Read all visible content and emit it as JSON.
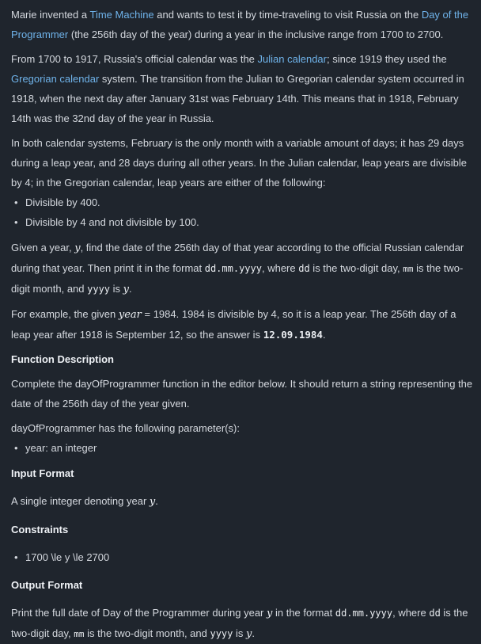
{
  "intro": {
    "t1": "Marie invented a ",
    "time_machine_link": "Time Machine",
    "t2": " and wants to test it by time-traveling to visit Russia on the ",
    "day_link": "Day of the Programmer",
    "t3": " (the 256th day of the year) during a year in the inclusive range from 1700 to 2700."
  },
  "history": {
    "t1": "From 1700 to 1917, Russia's official calendar was the ",
    "julian_link": "Julian calendar",
    "t2": "; since 1919 they used the ",
    "gregorian_link": "Gregorian calendar",
    "t3": " system. The transition from the Julian to Gregorian calendar system occurred in 1918, when the next day after January 31st was February 14th. This means that in 1918, February 14th was the 32nd day of the year in Russia."
  },
  "leap": {
    "text": "In both calendar systems, February is the only month with a variable amount of days; it has 29 days during a leap year, and 28 days during all other years. In the Julian calendar, leap years are divisible by 4; in the Gregorian calendar, leap years are either of the following:",
    "rules": [
      "Divisible by 400.",
      "Divisible by 4 and not divisible by 100."
    ]
  },
  "task": {
    "t1": "Given a year, ",
    "var_y": "y",
    "t2": ", find the date of the 256th day of that year according to the official Russian calendar during that year. Then print it in the format ",
    "fmt": "dd.mm.yyyy",
    "t3": ", where ",
    "dd": "dd",
    "t4": " is the two-digit day, ",
    "mm": "mm",
    "t5": " is the two-digit month, and ",
    "yyyy": "yyyy",
    "t6": " is ",
    "var_y2": "y",
    "t7": "."
  },
  "example": {
    "t1": "For example, the given ",
    "var_year": "year",
    "t2": " = 1984. 1984 is divisible by 4, so it is a leap year. The 256th day of a leap year after 1918 is September 12, so the answer is ",
    "answer": "12.09.1984",
    "t3": "."
  },
  "function_description": {
    "heading": "Function Description",
    "text": "Complete the dayOfProgrammer function in the editor below. It should return a string representing the date of the 256th day of the year given.",
    "params_intro": "dayOfProgrammer has the following parameter(s):",
    "params": [
      "year: an integer"
    ]
  },
  "input_format": {
    "heading": "Input Format",
    "t1": "A single integer denoting year ",
    "var_y": "y",
    "t2": "."
  },
  "constraints": {
    "heading": "Constraints",
    "items": [
      "1700 \\le y \\le 2700"
    ]
  },
  "output_format": {
    "heading": "Output Format",
    "t1": "Print the full date of Day of the Programmer during year ",
    "var_y": "y",
    "t2": " in the format ",
    "fmt": "dd.mm.yyyy",
    "t3": ", where ",
    "dd": "dd",
    "t4": " is the two-digit day, ",
    "mm": "mm",
    "t5": " is the two-digit month, and ",
    "yyyy": "yyyy",
    "t6": " is ",
    "var_y2": "y",
    "t7": "."
  }
}
